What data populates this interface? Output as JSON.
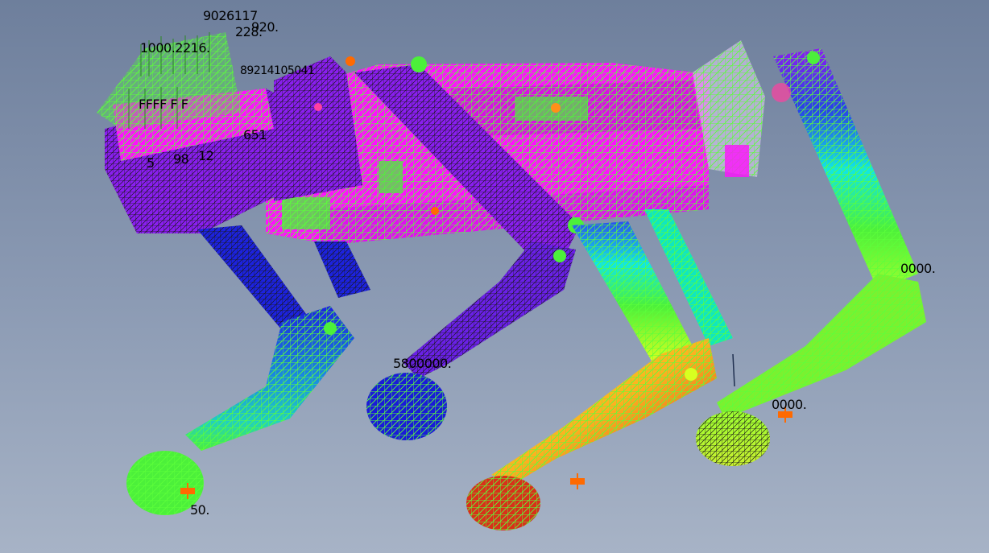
{
  "viewport": {
    "background_top": "#6e7f9c",
    "background_bottom": "#a7b3c6",
    "mesh_line_color": "#5cff3a"
  },
  "colors": {
    "body_magenta": "#ff10ff",
    "body_purple": "#8a1ef0",
    "leg_blue": "#1c22e0",
    "leg_cyan": "#10e6e6",
    "leg_green": "#4cf03a",
    "leg_yellow": "#d8ff20",
    "foot_orange": "#ff9018",
    "foot_red": "#d8301a",
    "marker_orange": "#ff6a00"
  },
  "labels": {
    "top_cluster_1": "9026117",
    "top_cluster_2": "920.",
    "top_cluster_3": "1000.2216.",
    "top_cluster_4": "228.",
    "mid_cluster_1": "89214105041",
    "mid_cluster_2": "FFFF F F",
    "side_5": "5",
    "side_98": "98",
    "side_12": "12",
    "side_651": "651",
    "front_foot": "50.",
    "center_value": "5800000.",
    "rear_right_value": "0000.",
    "rear_foot_value": "0000."
  }
}
